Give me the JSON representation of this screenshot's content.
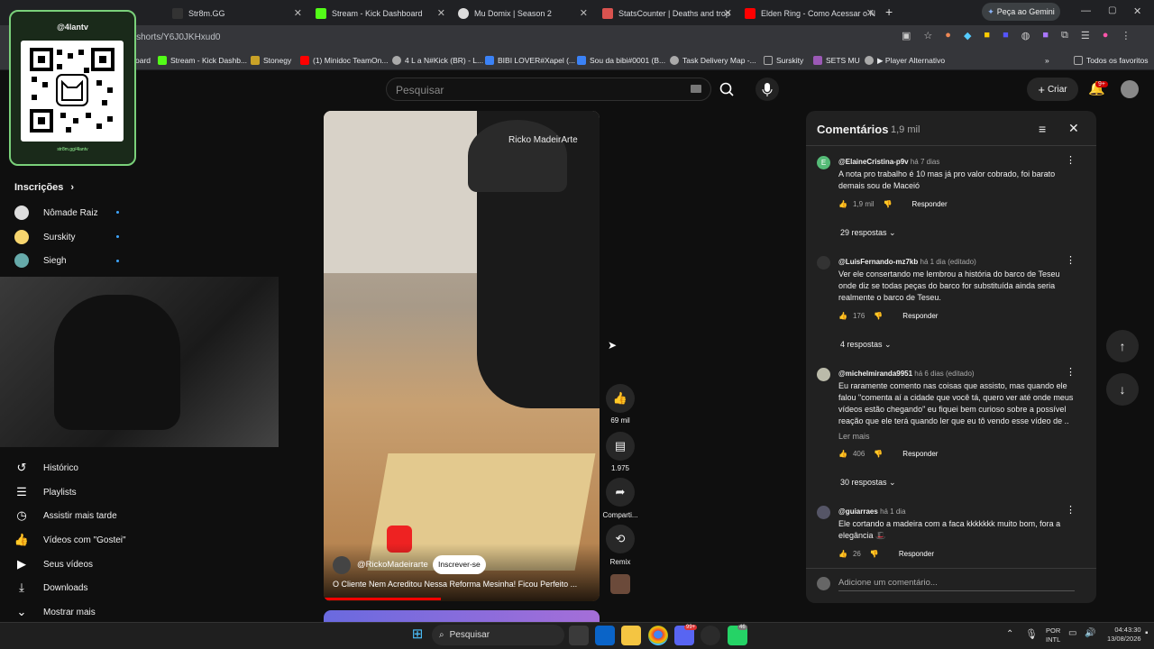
{
  "browser": {
    "tabs": [
      {
        "label": "Str8m.GG",
        "color": "#222"
      },
      {
        "label": "Stream - Kick Dashboard",
        "color": "#53fc18"
      },
      {
        "label": "Mu Domix | Season 2",
        "color": "#888"
      },
      {
        "label": "StatsCounter | Deaths and trop",
        "color": "#d9534f"
      },
      {
        "label": "Elden Ring - Como Acessar o N",
        "color": "#ff0000"
      }
    ],
    "gemini_label": "Peça ao Gemini",
    "url": "m/shorts/Y6J0JKHxud0",
    "bookmarks": [
      {
        "label": "oard",
        "color": "#888"
      },
      {
        "label": "Stream - Kick Dashb...",
        "color": "#53fc18"
      },
      {
        "label": "Stonegy",
        "color": "#c9a227"
      },
      {
        "label": "(1) Minidoc TeamOn...",
        "color": "#ff0000"
      },
      {
        "label": "4 L a N#Kick (BR) - L...",
        "color": "#aaa"
      },
      {
        "label": "BIBI LOVER#Xapel (...",
        "color": "#3b82f6"
      },
      {
        "label": "Sou da bibi#0001 (B...",
        "color": "#3b82f6"
      },
      {
        "label": "Task Delivery Map -...",
        "color": "#aaa"
      },
      {
        "label": "Surskity",
        "color": "#aaa"
      },
      {
        "label": "SETS MU",
        "color": "#9b59b6"
      },
      {
        "label": "▶ Player Alternativo",
        "color": "#aaa"
      }
    ],
    "all_favorites": "Todos os favoritos"
  },
  "overlay": {
    "handle": "@4lantv",
    "url": "str8m.gg/4lantv"
  },
  "youtube": {
    "search_placeholder": "Pesquisar",
    "create_label": "Criar",
    "notifications": "9+",
    "subscriptions_title": "Inscrições",
    "subscriptions": [
      "Nômade Raiz",
      "Surskity",
      "Siegh"
    ],
    "menu": [
      "Histórico",
      "Playlists",
      "Assistir mais tarde",
      "Vídeos com \"Gostei\"",
      "Seus vídeos",
      "Downloads",
      "Mostrar mais"
    ]
  },
  "video": {
    "watermark": "Ricko MadeirArte",
    "channel": "@RickoMadeirarte",
    "subscribe": "Inscrever-se",
    "title": "O Cliente Nem Acreditou Nessa Reforma Mesinha! Ficou Perfeito ..."
  },
  "actions": {
    "likes": "69 mil",
    "comments": "1.975",
    "share": "Comparti...",
    "remix": "Remix"
  },
  "comments": {
    "title": "Comentários",
    "count": "1,9 mil",
    "add_placeholder": "Adicione um comentário...",
    "items": [
      {
        "author": "@ElaineCristina-p9v",
        "time": "há 7 dias",
        "text": "A nota pro trabalho é 10 mas já pro valor cobrado, foi barato demais  sou de Maceió",
        "likes": "1,9 mil",
        "reply": "Responder",
        "replies": "29 respostas",
        "avatar_letter": "E"
      },
      {
        "author": "@LuisFernando-mz7kb",
        "time": "há 1 dia (editado)",
        "text": "Ver ele consertando me lembrou a história do barco de Teseu onde diz se todas peças do barco for substituída ainda seria realmente o barco de Teseu.",
        "likes": "176",
        "reply": "Responder",
        "replies": "4 respostas"
      },
      {
        "author": "@michelmiranda9951",
        "time": "há 6 dias (editado)",
        "text": "Eu raramente comento nas coisas que assisto, mas quando ele falou \"comenta aí a cidade que você tá, quero ver até onde meus vídeos estão chegando\" eu fiquei bem curioso sobre a possível reação que ele terá quando ler que eu tô vendo esse vídeo de ..",
        "more": "Ler mais",
        "likes": "406",
        "reply": "Responder",
        "replies": "30 respostas"
      },
      {
        "author": "@guiarraes",
        "time": "há 1 dia",
        "text": "Ele cortando a madeira com a faca kkkkkkk muito bom, fora a elegância 🎩",
        "likes": "26",
        "reply": "Responder"
      }
    ]
  },
  "taskbar": {
    "search": "Pesquisar",
    "lang1": "POR",
    "lang2": "INTL",
    "time": "04:43:30",
    "date": "13/08/2026",
    "badge1": "99+",
    "badge2": "46"
  }
}
